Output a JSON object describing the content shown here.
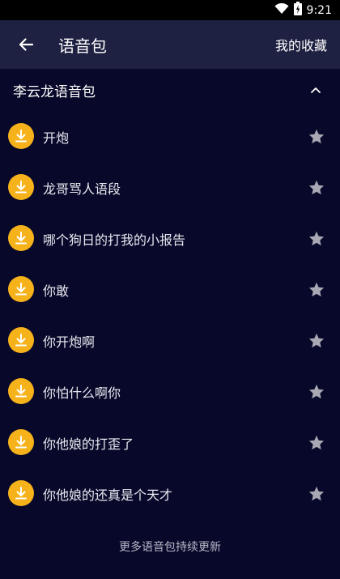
{
  "status_bar": {
    "time": "9:21",
    "icons": [
      "wifi-icon",
      "battery-icon"
    ]
  },
  "app_bar": {
    "title": "语音包",
    "favorites_label": "我的收藏",
    "back_icon": "back-arrow-icon"
  },
  "group": {
    "title": "李云龙语音包",
    "expanded": true
  },
  "items": [
    {
      "label": "开炮"
    },
    {
      "label": "龙哥骂人语段"
    },
    {
      "label": "哪个狗日的打我的小报告"
    },
    {
      "label": "你敢"
    },
    {
      "label": "你开炮啊"
    },
    {
      "label": "你怕什么啊你"
    },
    {
      "label": "你他娘的打歪了"
    },
    {
      "label": "你他娘的还真是个天才"
    }
  ],
  "footer": {
    "note": "更多语音包持续更新"
  },
  "colors": {
    "background": "#08082a",
    "app_bar": "#1f2142",
    "accent": "#f6b21a",
    "star": "#a8a8b4"
  }
}
